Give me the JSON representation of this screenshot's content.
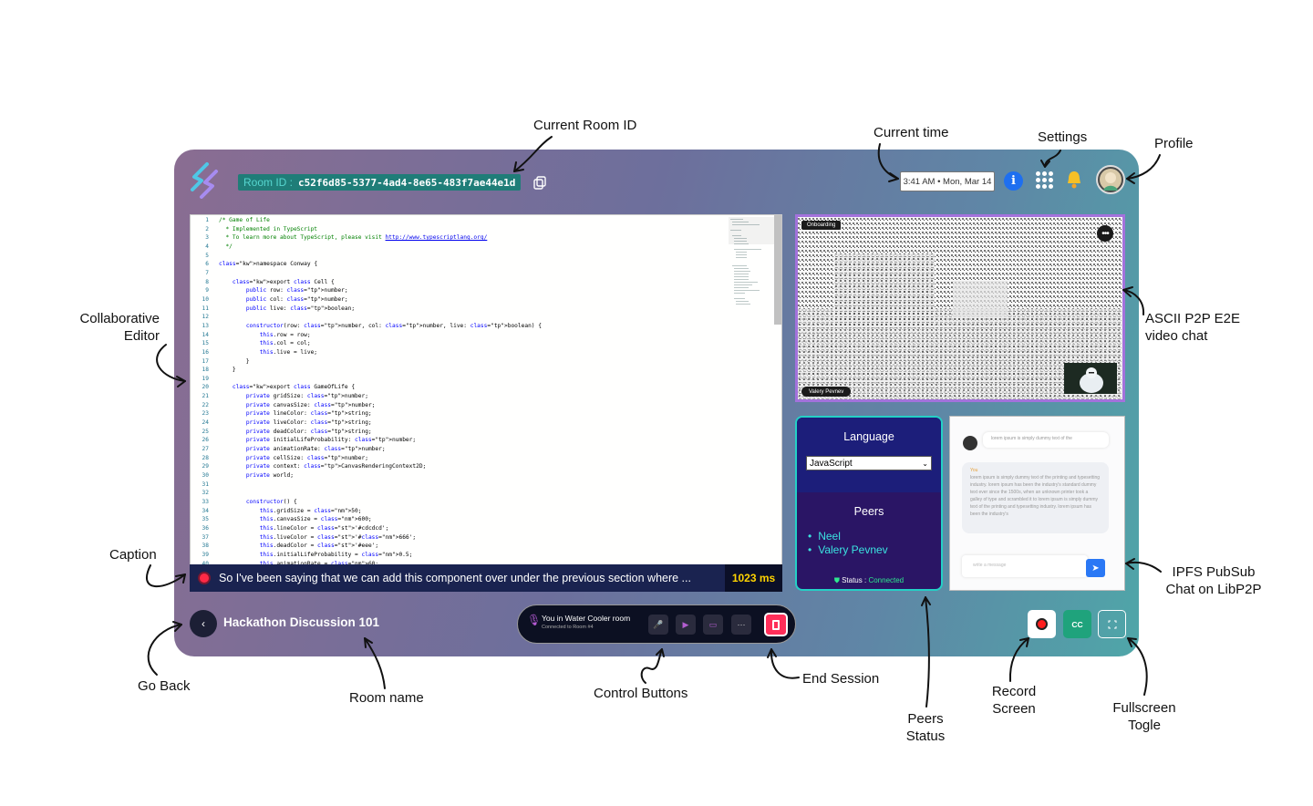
{
  "header": {
    "room_id_prefix": "Room ID :",
    "room_id": "c52f6d85-5377-4ad4-8e65-483f7ae44e1d",
    "time": "3:41 AM • Mon, Mar 14",
    "info_icon": "i"
  },
  "editor": {
    "lines": [
      "/* Game of Life",
      "  * Implemented in TypeScript",
      "  * To learn more about TypeScript, please visit http://www.typescriptlang.org/",
      "  */",
      "",
      "namespace Conway {",
      "",
      "    export class Cell {",
      "        public row: number;",
      "        public col: number;",
      "        public live: boolean;",
      "",
      "        constructor(row: number, col: number, live: boolean) {",
      "            this.row = row;",
      "            this.col = col;",
      "            this.live = live;",
      "        }",
      "    }",
      "",
      "    export class GameOfLife {",
      "        private gridSize: number;",
      "        private canvasSize: number;",
      "        private lineColor: string;",
      "        private liveColor: string;",
      "        private deadColor: string;",
      "        private initialLifeProbability: number;",
      "        private animationRate: number;",
      "        private cellSize: number;",
      "        private context: CanvasRenderingContext2D;",
      "        private world;",
      "",
      "",
      "        constructor() {",
      "            this.gridSize = 50;",
      "            this.canvasSize = 600;",
      "            this.lineColor = '#cdcdcd';",
      "            this.liveColor = '#666';",
      "            this.deadColor = '#eee';",
      "            this.initialLifeProbability = 0.5;",
      "            this.animationRate = 60;"
    ]
  },
  "caption": {
    "text": "So I've been saying that we can add this component over under the previous section where ...",
    "latency": "1023 ms"
  },
  "video": {
    "tag_top": "Onboarding",
    "tag_bottom": "Valery Pevnev"
  },
  "language_panel": {
    "heading": "Language",
    "selected": "JavaScript",
    "peers_heading": "Peers",
    "peers": [
      "Neel",
      "Valery Pevnev"
    ],
    "status_label": "Status :",
    "status_value": "Connected"
  },
  "chat": {
    "msg1": "lorem ipsum is simply dummy text of the",
    "you_label": "You",
    "msg2": "lorem ipsum is simply dummy text of the printing and typesetting industry. lorem ipsum has been the industry's standard dummy text ever since the 1500s, when an unknown printer took a galley of type and scrambled it to lorem ipsum is simply dummy text of the printing and typesetting industry. lorem ipsum has been the industry's",
    "input_placeholder": "write a message"
  },
  "bottom": {
    "room_name": "Hackathon Discussion 101",
    "control_title": "You in Water Cooler room",
    "control_sub": "Connected to Room #4",
    "cc_label": "CC"
  },
  "annotations": {
    "current_room_id": "Current Room ID",
    "current_time": "Current time",
    "settings": "Settings",
    "profile": "Profile",
    "collab_editor_1": "Collaborative",
    "collab_editor_2": "Editor",
    "ascii_1": "ASCII P2P E2E",
    "ascii_2": "video chat",
    "caption": "Caption",
    "ipfs_1": "IPFS PubSub",
    "ipfs_2": "Chat on LibP2P",
    "go_back": "Go Back",
    "room_name": "Room name",
    "control_buttons": "Control Buttons",
    "end_session": "End Session",
    "peers_status_1": "Peers",
    "peers_status_2": "Status",
    "record_1": "Record",
    "record_2": "Screen",
    "fullscreen_1": "Fullscreen",
    "fullscreen_2": "Togle"
  }
}
